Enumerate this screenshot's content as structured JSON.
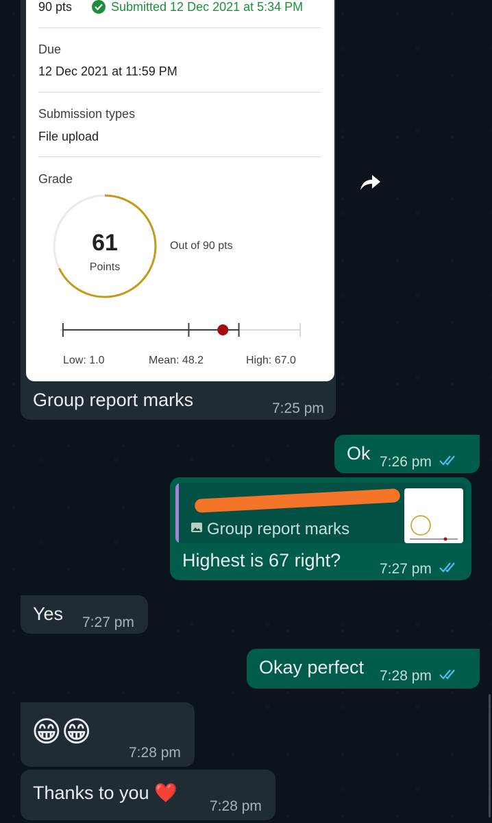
{
  "assignment_card": {
    "points": "90 pts",
    "submitted_status": "Submitted 12 Dec 2021 at 5:34 PM",
    "due_label": "Due",
    "due_value": "12 Dec 2021 at 11:59 PM",
    "submission_types_label": "Submission types",
    "submission_types_value": "File upload",
    "grade_label": "Grade",
    "grade_value": "61",
    "grade_unit": "Points",
    "out_of": "Out of 90 pts",
    "low": "Low: 1.0",
    "mean": "Mean: 48.2",
    "high": "High: 67.0",
    "grade_ring_fraction": 0.678,
    "score_scale": {
      "low": 1.0,
      "mean": 48.2,
      "score": 61,
      "high": 67.0,
      "max": 90
    },
    "accent_color": "#1e8e3e",
    "ring_color": "#c59a16"
  },
  "messages": [
    {
      "id": "m1",
      "direction": "incoming",
      "text": "Group report marks",
      "time": "7:25 pm",
      "has_image": true
    },
    {
      "id": "m2",
      "direction": "outgoing",
      "text": "Ok",
      "time": "7:26 pm",
      "read": true
    },
    {
      "id": "m3",
      "direction": "outgoing",
      "reply_to": "Group report marks",
      "text": "Highest is 67 right?",
      "time": "7:27 pm",
      "read": true
    },
    {
      "id": "m4",
      "direction": "incoming",
      "text": "Yes",
      "time": "7:27 pm"
    },
    {
      "id": "m5",
      "direction": "outgoing",
      "text": "Okay perfect",
      "time": "7:28 pm",
      "read": true
    },
    {
      "id": "m6",
      "direction": "incoming",
      "text": "😁😁",
      "time": "7:28 pm"
    },
    {
      "id": "m7",
      "direction": "incoming",
      "text": "Thanks to you ❤️",
      "time": "7:28 pm"
    }
  ],
  "colors": {
    "background": "#0b141a",
    "incoming": "#1f2c33",
    "outgoing": "#005c4b",
    "ticks": "#53bdeb"
  },
  "icons": {
    "forward": "forward-arrow-icon",
    "read": "double-check-icon",
    "image": "image-icon"
  }
}
